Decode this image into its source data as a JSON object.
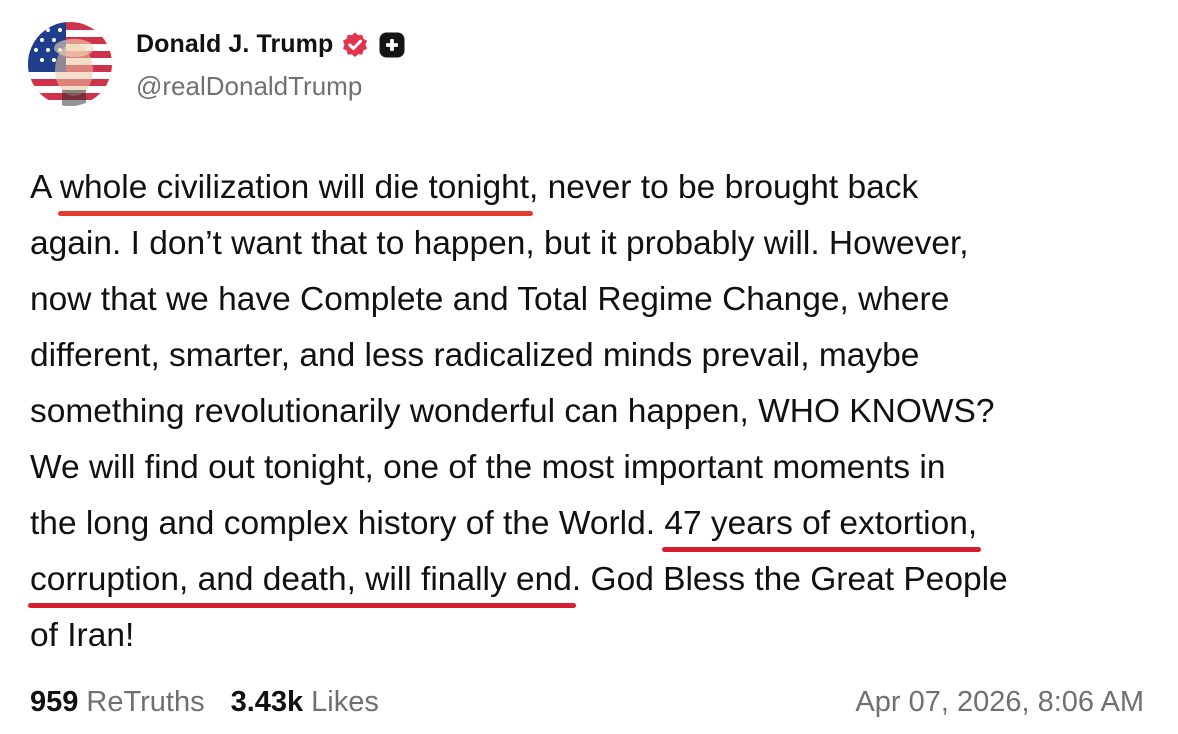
{
  "author": {
    "display_name": "Donald J. Trump",
    "handle": "@realDonaldTrump",
    "badges": [
      "verified-badge-icon",
      "plus-badge-icon"
    ],
    "badge_color": "#e0344f"
  },
  "post": {
    "lines": [
      [
        {
          "text": "A "
        },
        {
          "text": "whole civilization will die tonight",
          "highlight": true
        },
        {
          "text": ", never to be brought back"
        }
      ],
      [
        {
          "text": "again. I don’t want that to happen, but it probably will. However,"
        }
      ],
      [
        {
          "text": "now that we have Complete and Total Regime Change, where"
        }
      ],
      [
        {
          "text": "different, smarter, and less radicalized minds prevail, maybe"
        }
      ],
      [
        {
          "text": "something revolutionarily wonderful can happen, WHO KNOWS?"
        }
      ],
      [
        {
          "text": "We will find out tonight, one of the most important moments in"
        }
      ],
      [
        {
          "text": "the long and complex history of the World. "
        },
        {
          "text": "47 years of extortion,",
          "highlight": true
        }
      ],
      [
        {
          "text": "corruption, and death, will finally end",
          "highlight": true
        },
        {
          "text": ". God Bless the Great People"
        }
      ],
      [
        {
          "text": "of Iran!"
        }
      ]
    ],
    "highlight_colors": [
      "#e23b2c",
      "#d81e30",
      "#d81e30"
    ]
  },
  "stats": {
    "retruths_count": "959",
    "retruths_label": "ReTruths",
    "likes_count": "3.43k",
    "likes_label": "Likes"
  },
  "timestamp": "Apr 07, 2026, 8:06 AM"
}
